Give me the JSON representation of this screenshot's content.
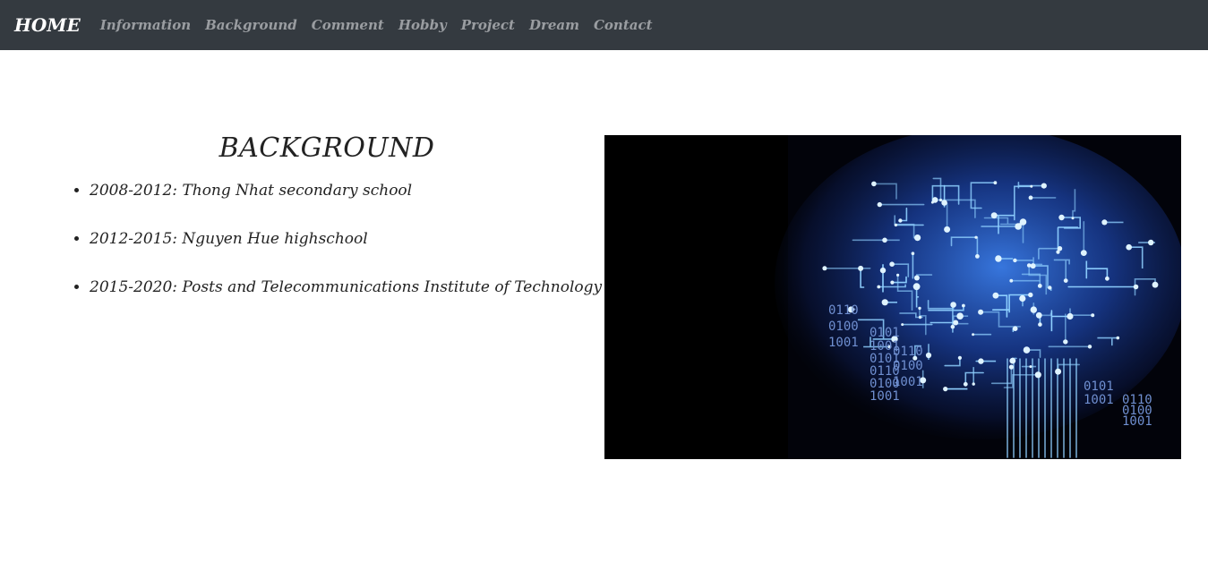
{
  "nav": {
    "brand": "HOME",
    "links": [
      "Information",
      "Background",
      "Comment",
      "Hobby",
      "Project",
      "Dream",
      "Contact"
    ]
  },
  "background": {
    "title": "BACKGROUND",
    "items": [
      "2008-2012: Thong Nhat secondary school",
      "2012-2015: Nguyen Hue highschool",
      "2015-2020: Posts and Telecommunications Institute of Technology"
    ]
  },
  "image": {
    "binary_text": [
      "0110",
      "0100",
      "1001",
      "0101",
      "1001",
      "0101",
      "0110",
      "0100",
      "1001",
      "0110",
      "0100",
      "1001",
      "0101",
      "1001",
      "0110",
      "0100",
      "1001"
    ]
  },
  "colors": {
    "navbar": "#343a40",
    "brand": "#ffffff",
    "nav_link": "#9a9da1",
    "text": "#222222",
    "glow": "#4aa8ff"
  }
}
